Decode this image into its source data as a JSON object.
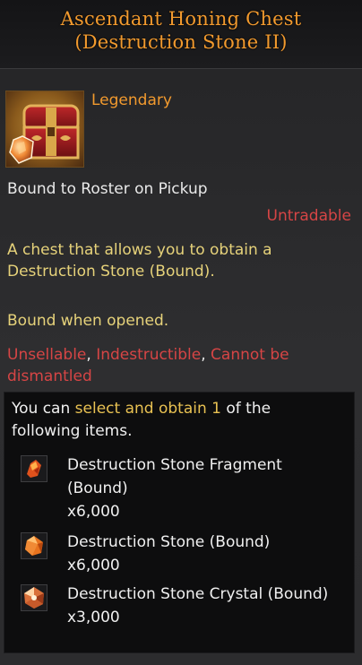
{
  "title_line1": "Ascendant Honing Chest",
  "title_line2": "(Destruction Stone II)",
  "item_icon": "treasure-chest-icon",
  "grade": "Legendary",
  "bound_info": "Bound to Roster on Pickup",
  "trade_status": "Untradable",
  "description": "A chest that allows you to obtain a Destruction Stone (Bound).",
  "bound_when_opened": "Bound when opened.",
  "restrictions": {
    "unsellable": "Unsellable",
    "indestructible": "Indestructible",
    "cannot_dismantle_1": "Cannot be",
    "cannot_dismantle_2": "dismantled"
  },
  "selection": {
    "prefix": "You can ",
    "highlight_action": "select and obtain",
    "count": "1",
    "suffix": "of the following items."
  },
  "rewards": [
    {
      "name_line1": "Destruction Stone Fragment",
      "name_line2": "(Bound)",
      "qty": "x6,000",
      "icon": "fragment-icon"
    },
    {
      "name_line1": "Destruction Stone (Bound)",
      "name_line2": "",
      "qty": "x6,000",
      "icon": "stone-icon"
    },
    {
      "name_line1": "Destruction Stone Crystal (Bound)",
      "name_line2": "",
      "qty": "x3,000",
      "icon": "crystal-icon"
    }
  ],
  "colors": {
    "title": "#f29a2e",
    "legendary": "#f29a2e",
    "description": "#e6d27a",
    "restriction": "#d64545",
    "highlight": "#e8c152"
  }
}
